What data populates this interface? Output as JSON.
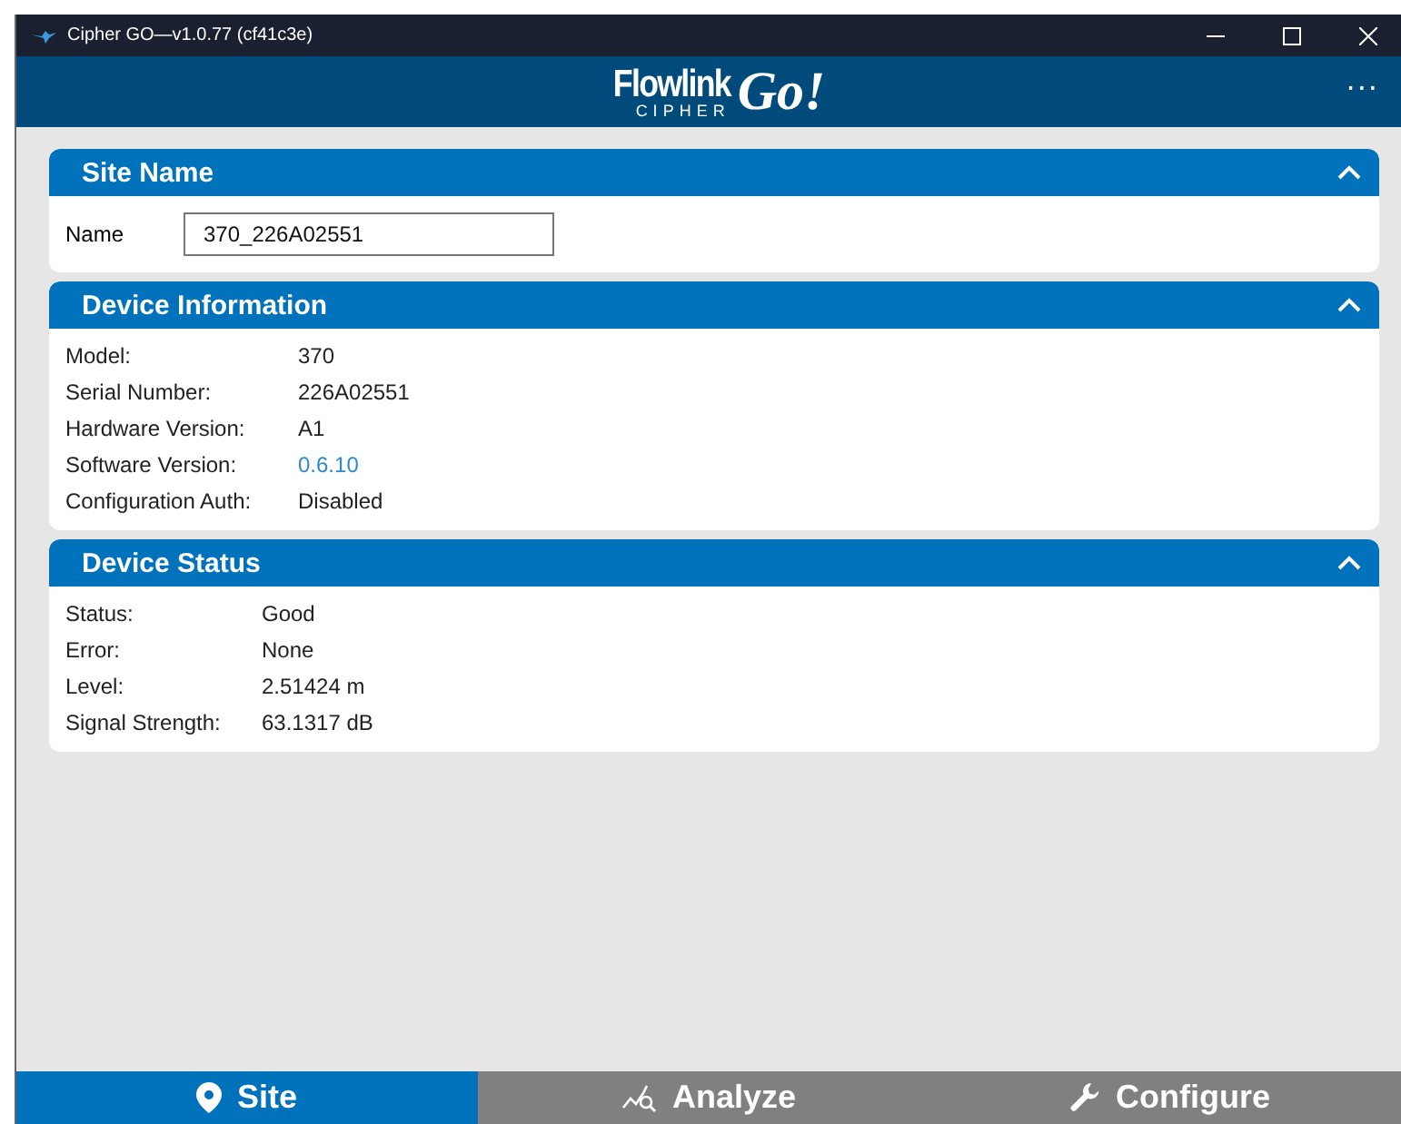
{
  "window": {
    "title": "Cipher GO—v1.0.77 (cf41c3e)"
  },
  "header": {
    "logo": {
      "brand": "Flowlink",
      "sub": "CIPHER",
      "product": "Go!"
    },
    "menu": "···"
  },
  "sections": [
    {
      "title": "Site Name",
      "expanded": true,
      "kind": "form",
      "field": {
        "label": "Name",
        "value": "370_226A02551"
      }
    },
    {
      "title": "Device Information",
      "expanded": true,
      "kind": "details",
      "rows": [
        {
          "label": "Model:",
          "value": "370",
          "link": false
        },
        {
          "label": "Serial Number:",
          "value": "226A02551",
          "link": false
        },
        {
          "label": "Hardware Version:",
          "value": "A1",
          "link": false
        },
        {
          "label": "Software Version:",
          "value": "0.6.10",
          "link": true
        },
        {
          "label": "Configuration Auth:",
          "value": "Disabled",
          "link": false
        }
      ]
    },
    {
      "title": "Device Status",
      "expanded": true,
      "kind": "details",
      "rows": [
        {
          "label": "Status:",
          "value": "Good",
          "link": false
        },
        {
          "label": "Error:",
          "value": "None",
          "link": false
        },
        {
          "label": "Level:",
          "value": "2.51424 m",
          "link": false
        },
        {
          "label": "Signal Strength:",
          "value": "63.1317 dB",
          "link": false
        }
      ]
    }
  ],
  "tabs": [
    {
      "label": "Site",
      "kind": "pin",
      "selected": true
    },
    {
      "label": "Analyze",
      "kind": "chart",
      "selected": false
    },
    {
      "label": "Configure",
      "kind": "wrench",
      "selected": false
    }
  ]
}
